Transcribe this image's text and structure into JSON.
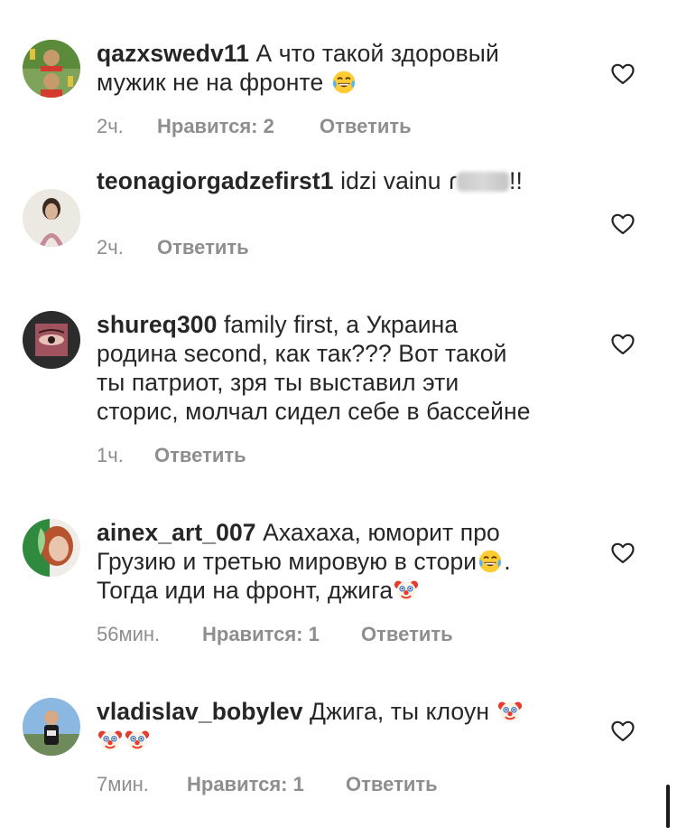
{
  "comments": [
    {
      "username": "qazxswedv11",
      "text_1": "А что такой здоровый",
      "text_2": "мужик не на фронте",
      "emoji": "laughing-tears-emoji",
      "time": "2ч.",
      "likes": "Нравится: 2",
      "reply": "Ответить"
    },
    {
      "username": "teonagiorgadzefirst1",
      "text_1": "idzi vainu ",
      "text_2": "!!",
      "time": "2ч.",
      "reply": "Ответить"
    },
    {
      "username": "shureq300",
      "text_1": "family first, а Украина",
      "text_2": "родина second, как так??? Вот такой",
      "text_3": "ты патриот, зря ты выставил эти",
      "text_4": "сторис, молчал сидел себе в бассейне",
      "time": "1ч.",
      "reply": "Ответить"
    },
    {
      "username": "ainex_art_007",
      "text_1": "Ахахаха, юморит про",
      "text_2": "Грузию и третью мировую в стори",
      "text_2_end": ".",
      "text_3": "Тогда иди на фронт, джига",
      "time": "56мин.",
      "likes": "Нравится: 1",
      "reply": "Ответить"
    },
    {
      "username": "vladislav_bobylev",
      "text_1": "Джига, ты клоун",
      "time": "7мин.",
      "likes": "Нравится: 1",
      "reply": "Ответить"
    }
  ],
  "icons": {
    "heart": "heart-outline-icon",
    "laugh": "laughing-tears-emoji",
    "clown": "clown-face-emoji"
  },
  "colors": {
    "text": "#262626",
    "meta": "#8e8e8e",
    "background": "#ffffff"
  }
}
